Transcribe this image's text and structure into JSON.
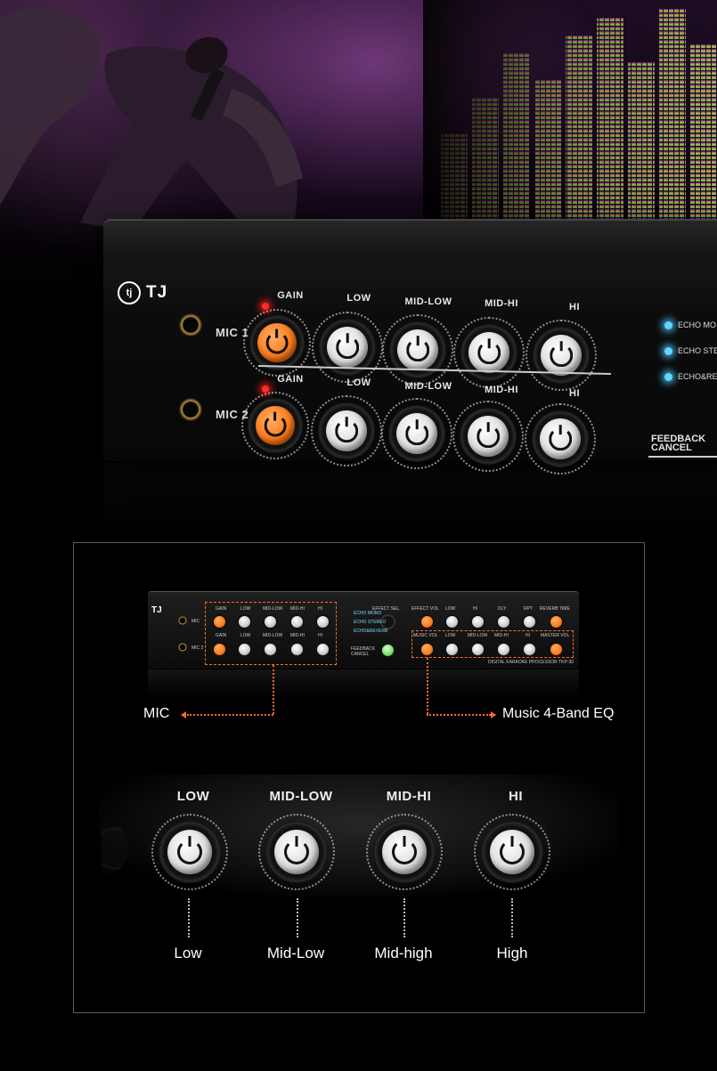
{
  "hero": {
    "brand": "TJ",
    "brand_mark": "tj",
    "mic1_label": "MIC 1",
    "mic2_label": "MIC 2",
    "row1_labels": [
      "GAIN",
      "LOW",
      "MID-LOW",
      "MID-HI",
      "HI"
    ],
    "row2_labels": [
      "GAIN",
      "LOW",
      "MID-LOW",
      "MID-HI",
      "HI"
    ],
    "effect_labels": [
      "ECHO MO",
      "ECHO STE",
      "ECHO&RE"
    ],
    "feedback_label": "FEEDBACK\nCANCEL"
  },
  "diagram": {
    "mini_brand": "TJ",
    "mini_mic_labels": [
      "MIC",
      "MIC 2"
    ],
    "mini_top_left": [
      "GAIN",
      "LOW",
      "MID-LOW",
      "MID-HI",
      "HI"
    ],
    "mini_bottom_left": [
      "GAIN",
      "LOW",
      "MID-LOW",
      "MID-HI",
      "HI"
    ],
    "mini_effect_sel": "EFFECT SEL.",
    "mini_effect_opts": [
      "ECHO MONO",
      "ECHO STEREO",
      "ECHO&REVERB"
    ],
    "mini_feedback": "FEEDBACK CANCEL",
    "mini_top_right": [
      "EFFECT VOL",
      "LOW",
      "HI",
      "DLY",
      "RPT",
      "REVERB TIME"
    ],
    "mini_bottom_right": [
      "MUSIC VOL",
      "LOW",
      "MID-LOW",
      "MID-HI",
      "HI",
      "MASTER VOL"
    ],
    "mini_model": "DIGITAL KARAOKE PROCESSOR  TKP-30",
    "callout_left": "MIC",
    "callout_right": "Music 4-Band EQ"
  },
  "eq_strip": {
    "knob_labels": [
      "LOW",
      "MID-LOW",
      "MID-HI",
      "HI"
    ],
    "band_labels": [
      "Low",
      "Mid-Low",
      "Mid-high",
      "High"
    ]
  },
  "colors": {
    "accent": "#ff6a2a",
    "knob_orange": "#ff7a1a",
    "led_red": "#ff2a2a",
    "led_blue": "#5fd6ff"
  }
}
